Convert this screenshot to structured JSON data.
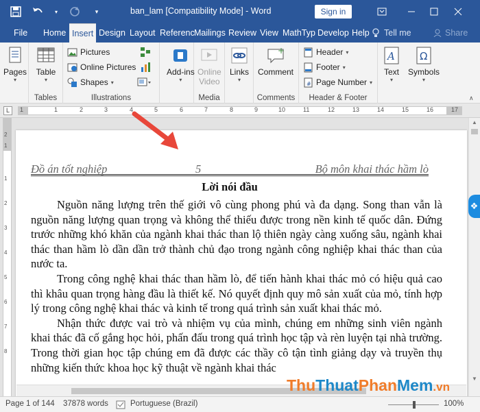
{
  "titlebar": {
    "doc_title": "ban_lam [Compatibility Mode]  -  Word",
    "signin_label": "Sign in",
    "icons": [
      "save-icon",
      "undo-icon",
      "redo-icon",
      "customize-qat-icon",
      "ribbon-display-icon",
      "minimize-icon",
      "maximize-icon",
      "close-icon"
    ]
  },
  "tabs": [
    {
      "label": "File"
    },
    {
      "label": "Home"
    },
    {
      "label": "Insert",
      "active": true
    },
    {
      "label": "Design"
    },
    {
      "label": "Layout"
    },
    {
      "label": "Referenc"
    },
    {
      "label": "Mailings"
    },
    {
      "label": "Review"
    },
    {
      "label": "View"
    },
    {
      "label": "MathTyp"
    },
    {
      "label": "Develop"
    },
    {
      "label": "Help"
    }
  ],
  "tellme": "Tell me",
  "share": "Share",
  "ribbon": {
    "pages": {
      "label": "Pages"
    },
    "tables": {
      "table_label": "Table",
      "group": "Tables"
    },
    "illustrations": {
      "pictures": "Pictures",
      "online_pictures": "Online Pictures",
      "shapes": "Shapes",
      "group": "Illustrations"
    },
    "addins": {
      "label": "Add-ins"
    },
    "media": {
      "online_video_line1": "Online",
      "online_video_line2": "Video",
      "group": "Media"
    },
    "links": {
      "label": "Links"
    },
    "comments": {
      "comment": "Comment",
      "group": "Comments"
    },
    "header_footer": {
      "header": "Header",
      "footer": "Footer",
      "page_number": "Page Number",
      "group": "Header & Footer"
    },
    "text": {
      "label": "Text"
    },
    "symbols": {
      "label": "Symbols"
    }
  },
  "ruler": {
    "numbers": [
      "1",
      "2",
      "1",
      "1",
      "2",
      "3",
      "4",
      "5",
      "6",
      "7",
      "8",
      "9",
      "10",
      "11",
      "12",
      "13",
      "14",
      "15",
      "16",
      "17"
    ]
  },
  "vruler": {
    "numbers": [
      "2",
      "1",
      "1",
      "2",
      "3",
      "4",
      "5",
      "6",
      "7",
      "8",
      "9",
      "10"
    ]
  },
  "document": {
    "header_left": "Đồ án tốt nghiệp",
    "header_page": "5",
    "header_right": "Bộ môn khai thác hầm lò",
    "heading": "Lời nói đầu",
    "paragraphs": [
      "Nguồn năng lượng trên thế giới vô cùng phong phú và đa dạng. Song than vẫn là nguồn năng lượng quan trọng và không thể thiếu được trong nền kinh tế quốc dân. Đứng trước những khó khăn của ngành khai thác than lộ thiên ngày càng xuống sâu, ngành khai thác than hầm lò dần dần trở thành chủ đạo trong ngành công nghiệp khai thác than của nước ta.",
      "Trong công nghệ khai thác than hầm lò, để tiến hành khai thác mỏ có hiệu quả cao thì khâu quan trọng hàng đầu là thiết kế.  Nó quyết định quy mô sản xuất của mỏ, tính hợp lý trong công nghệ khai thác và kinh tế trong quá trình sản xuất khai thác mỏ.",
      "Nhận thức được vai trò và nhiệm vụ của mình, chúng em những sinh viên ngành khai thác đã cố gắng học hỏi, phấn đấu trong quá trình học tập và rèn luyện tại nhà trường. Trong thời gian học tập chúng em đã được các thầy cô tận tình giảng dạy và truyền thụ những kiến thức khoa học kỹ thuật về ngành khai thác"
    ]
  },
  "statusbar": {
    "page": "Page 1 of 144",
    "words": "37878 words",
    "language": "Portuguese (Brazil)",
    "zoom": "100%"
  },
  "watermark": {
    "part1": "Thu",
    "part2": "Thuat",
    "part3": "Phan",
    "part4": "Mem",
    "part5": ".vn"
  },
  "colors": {
    "accent": "#2b579a",
    "annotation_arrow": "#e8473a"
  }
}
